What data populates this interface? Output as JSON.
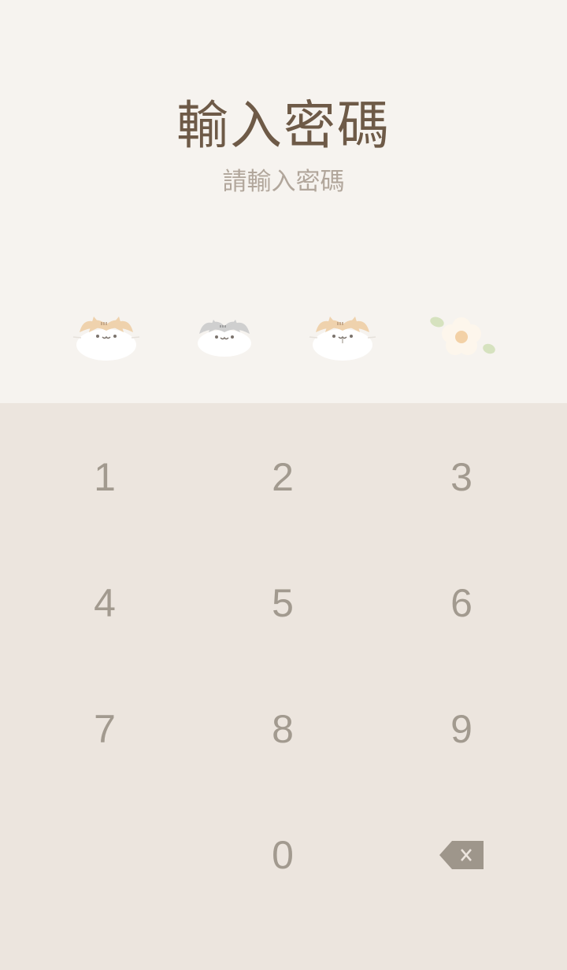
{
  "header": {
    "title": "輸入密碼",
    "subtitle": "請輸入密碼"
  },
  "pin_indicators": [
    {
      "state": "filled",
      "icon": "orange-cat-icon"
    },
    {
      "state": "filled",
      "icon": "gray-cat-icon"
    },
    {
      "state": "filled",
      "icon": "orange-cat-icon"
    },
    {
      "state": "empty",
      "icon": "flower-icon"
    }
  ],
  "keypad": {
    "keys": [
      "1",
      "2",
      "3",
      "4",
      "5",
      "6",
      "7",
      "8",
      "9",
      "0"
    ],
    "backspace_icon": "backspace-icon"
  },
  "colors": {
    "top_background": "#f6f3ef",
    "keypad_background": "#ece5de",
    "title": "#6e5a47",
    "subtitle": "#b1a69b",
    "key_text": "#a29a8f",
    "backspace": "#9e968b",
    "cat_orange": "#efd2ad",
    "cat_gray": "#cfcfcf",
    "flower_petal": "#fdf6ec",
    "flower_center": "#f3d1a6",
    "leaf": "#d6e2bf"
  }
}
